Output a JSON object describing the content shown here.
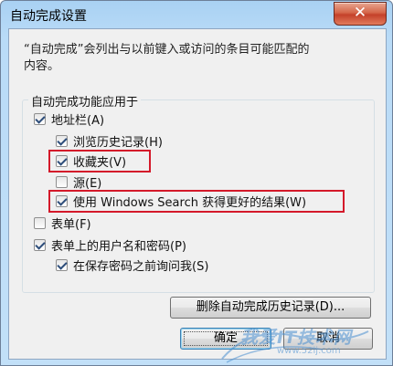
{
  "window": {
    "title": "自动完成设置",
    "close_label": "✕"
  },
  "description": "“自动完成”会列出与以前键入或访问的条目可能匹配的\n内容。",
  "group": {
    "label": "自动完成功能应用于",
    "options": [
      {
        "label": "地址栏(A)",
        "checked": true
      },
      {
        "label": "浏览历史记录(H)",
        "checked": true
      },
      {
        "label": "收藏夹(V)",
        "checked": true
      },
      {
        "label": "源(E)",
        "checked": false
      },
      {
        "label": "使用 Windows Search 获得更好的结果(W)",
        "checked": true
      },
      {
        "label": "表单(F)",
        "checked": false
      },
      {
        "label": "表单上的用户名和密码(P)",
        "checked": true
      },
      {
        "label": "在保存密码之前询问我(S)",
        "checked": true
      }
    ]
  },
  "buttons": {
    "delete_history": "删除自动完成历史记录(D)...",
    "ok": "确定",
    "cancel": "取消"
  },
  "watermark": {
    "text": "我爱IT技术网",
    "url": "www.52ij.com"
  },
  "colors": {
    "highlight": "#d4192a",
    "title_gradient": "#b9dbf7",
    "close_button": "#c4412a"
  }
}
